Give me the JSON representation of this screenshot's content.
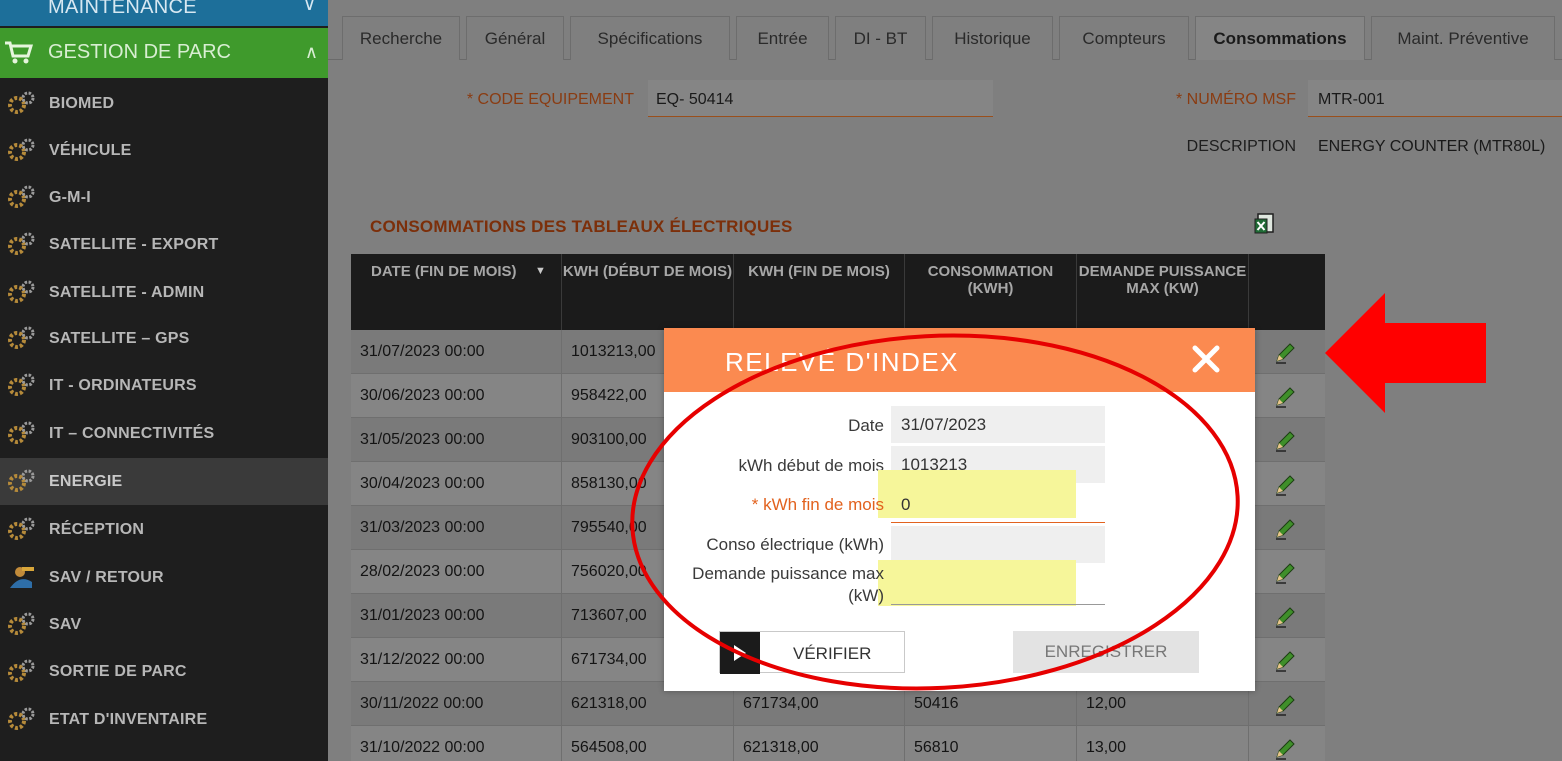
{
  "sidebar": {
    "maintenance_label": "MAINTENANCE",
    "gestion_label": "GESTION DE PARC",
    "items": [
      {
        "label": "BIOMED"
      },
      {
        "label": "VÉHICULE"
      },
      {
        "label": "G-M-I"
      },
      {
        "label": "SATELLITE - EXPORT"
      },
      {
        "label": "SATELLITE - ADMIN"
      },
      {
        "label": "SATELLITE – GPS"
      },
      {
        "label": "IT - ORDINATEURS"
      },
      {
        "label": "IT – CONNECTIVITÉS"
      },
      {
        "label": "ENERGIE"
      },
      {
        "label": "RÉCEPTION"
      },
      {
        "label": "SAV / RETOUR"
      },
      {
        "label": "SAV"
      },
      {
        "label": "SORTIE DE PARC"
      },
      {
        "label": "ETAT D'INVENTAIRE"
      }
    ]
  },
  "tabs": [
    {
      "label": "Recherche"
    },
    {
      "label": "Général"
    },
    {
      "label": "Spécifications"
    },
    {
      "label": "Entrée"
    },
    {
      "label": "DI - BT"
    },
    {
      "label": "Historique"
    },
    {
      "label": "Compteurs"
    },
    {
      "label": "Consommations"
    },
    {
      "label": "Maint. Préventive"
    }
  ],
  "form": {
    "code_label": "* CODE EQUIPEMENT",
    "code_value": "EQ- 50414",
    "msf_label": "* NUMÉRO MSF",
    "msf_value": "MTR-001",
    "desc_label": "DESCRIPTION",
    "desc_value": "ENERGY COUNTER (MTR80L)"
  },
  "section": {
    "title": "CONSOMMATIONS DES TABLEAUX ÉLECTRIQUES"
  },
  "table": {
    "headers": [
      "DATE (FIN DE MOIS)",
      "KWH (DÉBUT DE MOIS)",
      "KWH (FIN DE MOIS)",
      "CONSOMMATION (KWH)",
      "DEMANDE PUISSANCE MAX (KW)"
    ],
    "rows": [
      {
        "date": "31/07/2023 00:00",
        "start": "1013213,00",
        "end": "",
        "conso": "",
        "max": ""
      },
      {
        "date": "30/06/2023 00:00",
        "start": "958422,00",
        "end": "",
        "conso": "",
        "max": ""
      },
      {
        "date": "31/05/2023 00:00",
        "start": "903100,00",
        "end": "",
        "conso": "",
        "max": ""
      },
      {
        "date": "30/04/2023 00:00",
        "start": "858130,00",
        "end": "",
        "conso": "",
        "max": ""
      },
      {
        "date": "31/03/2023 00:00",
        "start": "795540,00",
        "end": "",
        "conso": "",
        "max": ""
      },
      {
        "date": "28/02/2023 00:00",
        "start": "756020,00",
        "end": "",
        "conso": "",
        "max": ""
      },
      {
        "date": "31/01/2023 00:00",
        "start": "713607,00",
        "end": "",
        "conso": "",
        "max": ""
      },
      {
        "date": "31/12/2022 00:00",
        "start": "671734,00",
        "end": "",
        "conso": "",
        "max": ""
      },
      {
        "date": "30/11/2022 00:00",
        "start": "621318,00",
        "end": "671734,00",
        "conso": "50416",
        "max": "12,00"
      },
      {
        "date": "31/10/2022 00:00",
        "start": "564508,00",
        "end": "621318,00",
        "conso": "56810",
        "max": "13,00"
      }
    ]
  },
  "modal": {
    "title": "RELEVÉ D'INDEX",
    "date_label": "Date",
    "date_value": "31/07/2023",
    "start_label": "kWh début de mois",
    "start_value": "1013213",
    "end_label": "* kWh fin de mois",
    "end_value": "0",
    "conso_label": "Conso électrique (kWh)",
    "conso_value": "",
    "max_label_1": "Demande puissance max",
    "max_label_2": "(kW)",
    "max_value": "",
    "verify_label": "VÉRIFIER",
    "save_label": "ENREGISTRER"
  },
  "colors": {
    "modal_header": "#fb8a50",
    "annotation": "#e60000",
    "highlight": "#ffffb0"
  }
}
